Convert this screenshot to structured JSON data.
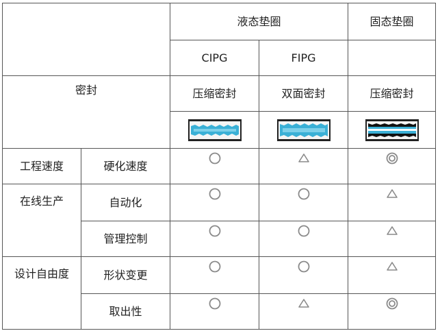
{
  "header": {
    "liquid": "液态垫圈",
    "solid": "固态垫圈",
    "cipg": "CIPG",
    "fipg": "FIPG",
    "seal": "密封",
    "cipg_seal": "压缩密封",
    "fipg_seal": "双面密封",
    "solid_seal": "压缩密封"
  },
  "seal_images": {
    "cipg": "compressed-seal-diagram",
    "fipg": "double-sided-seal-diagram",
    "solid": "compressed-seal-diagram",
    "fill_color": "#3ab0d6"
  },
  "legend": {
    "circle": "○",
    "triangle": "△",
    "double_circle": "◎"
  },
  "groups": [
    {
      "name": "工程速度",
      "rows": [
        {
          "label": "硬化速度",
          "marks": [
            "circle",
            "triangle",
            "double-circle"
          ]
        }
      ]
    },
    {
      "name": "在线生产",
      "rows": [
        {
          "label": "自动化",
          "marks": [
            "circle",
            "circle",
            "triangle"
          ]
        },
        {
          "label": "管理控制",
          "marks": [
            "circle",
            "circle",
            "triangle"
          ]
        }
      ]
    },
    {
      "name": "设计自由度",
      "rows": [
        {
          "label": "形状变更",
          "marks": [
            "circle",
            "circle",
            "triangle"
          ]
        },
        {
          "label": "取出性",
          "marks": [
            "circle",
            "triangle",
            "double-circle"
          ]
        }
      ]
    }
  ]
}
